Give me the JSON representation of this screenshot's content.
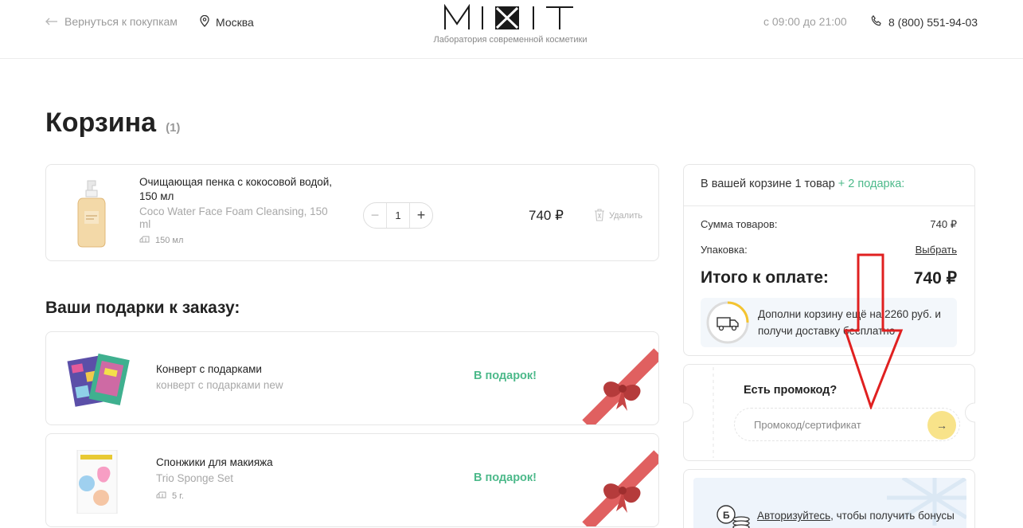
{
  "header": {
    "back_label": "Вернуться к покупкам",
    "city": "Москва",
    "logo_text": "MIXIT",
    "tagline": "Лаборатория современной косметики",
    "hours": "с 09:00 до 21:00",
    "phone": "8 (800) 551-94-03"
  },
  "page": {
    "title": "Корзина",
    "count": "(1)"
  },
  "cart_item": {
    "name": "Очищающая пенка с кокосовой водой, 150 мл",
    "subtitle": "Coco Water Face Foam Cleansing, 150 ml",
    "volume": "150 мл",
    "quantity": "1",
    "minus": "−",
    "plus": "+",
    "price": "740 ₽",
    "remove_label": "Удалить"
  },
  "gifts": {
    "title": "Ваши подарки к заказу:",
    "items": [
      {
        "name": "Конверт с подарками",
        "subtitle": "конверт с подарками new",
        "badge": "В подарок!"
      },
      {
        "name": "Спонжики для макияжа",
        "subtitle": "Trio Sponge Set",
        "volume": "5 г.",
        "badge": "В подарок!"
      }
    ]
  },
  "summary": {
    "head_text": "В вашей корзине 1 товар",
    "head_gifts": "+ 2 подарка:",
    "goods_label": "Сумма товаров:",
    "goods_value": "740 ₽",
    "pack_label": "Упаковка:",
    "pack_link": "Выбрать",
    "total_label": "Итого к оплате:",
    "total_value": "740 ₽",
    "delivery_text": "Дополни корзину ещё на 2260 руб. и получи доставку бесплатно",
    "delivery_progress": 0.25
  },
  "promo": {
    "title": "Есть промокод?",
    "placeholder": "Промокод/сертификат",
    "go": "→"
  },
  "bonus": {
    "link": "Авторизуйтесь",
    "text": ", чтобы получить бонусы"
  },
  "colors": {
    "accent_green": "#4cb98a",
    "promo_button": "#f8e38a",
    "annotation_arrow": "#e02020"
  }
}
